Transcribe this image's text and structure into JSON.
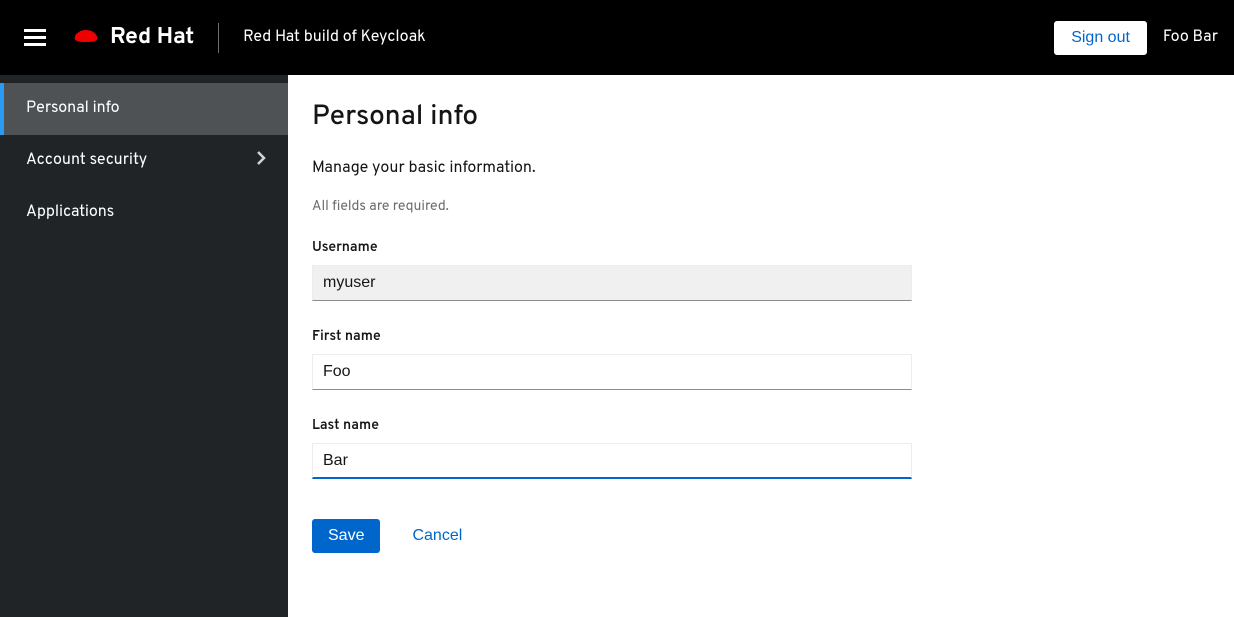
{
  "header": {
    "brand_name": "Red Hat",
    "product_name": "Red Hat build of Keycloak",
    "signout_label": "Sign out",
    "user_display_name": "Foo Bar"
  },
  "sidebar": {
    "items": [
      {
        "label": "Personal info",
        "active": true,
        "expandable": false
      },
      {
        "label": "Account security",
        "active": false,
        "expandable": true
      },
      {
        "label": "Applications",
        "active": false,
        "expandable": false
      }
    ]
  },
  "main": {
    "title": "Personal info",
    "subtitle": "Manage your basic information.",
    "required_note": "All fields are required.",
    "fields": {
      "username": {
        "label": "Username",
        "value": "myuser"
      },
      "first_name": {
        "label": "First name",
        "value": "Foo"
      },
      "last_name": {
        "label": "Last name",
        "value": "Bar"
      }
    },
    "buttons": {
      "save": "Save",
      "cancel": "Cancel"
    }
  }
}
